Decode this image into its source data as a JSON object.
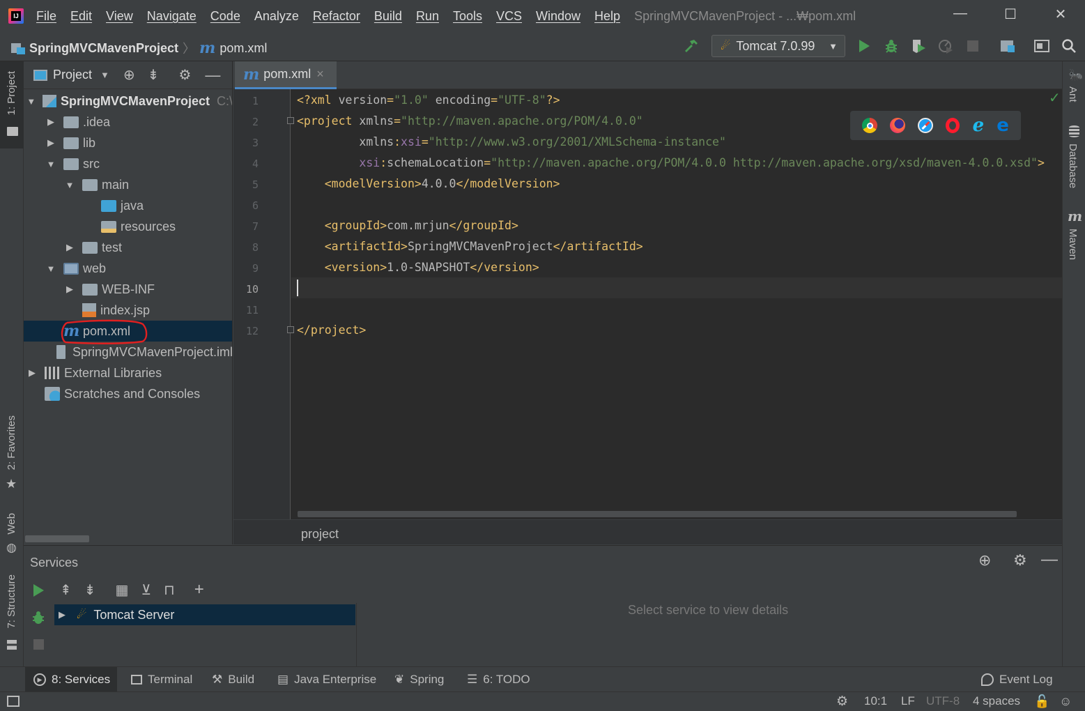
{
  "menu": {
    "items": [
      "File",
      "Edit",
      "View",
      "Navigate",
      "Code",
      "Analyze",
      "Refactor",
      "Build",
      "Run",
      "Tools",
      "VCS",
      "Window",
      "Help"
    ],
    "window_title": "SpringMVCMavenProject - ...₩pom.xml",
    "minimize": "—",
    "maximize": "☐",
    "close": "✕"
  },
  "navbar": {
    "breadcrumb_project": "SpringMVCMavenProject",
    "breadcrumb_file": "pom.xml",
    "run_config": "Tomcat 7.0.99"
  },
  "left_strip": {
    "project_label": "1: Project",
    "favorites_label": "2: Favorites",
    "web_label": "Web",
    "structure_label": "7: Structure"
  },
  "right_strip": {
    "ant_label": "Ant",
    "database_label": "Database",
    "maven_label": "Maven"
  },
  "project_panel": {
    "title": "Project",
    "tree": [
      {
        "label": "SpringMVCMavenProject",
        "suffix": "C:\\",
        "depth": 0,
        "arrow": "open",
        "icon": "module",
        "bold": true
      },
      {
        "label": ".idea",
        "depth": 1,
        "arrow": "closed",
        "icon": "folder"
      },
      {
        "label": "lib",
        "depth": 1,
        "arrow": "closed",
        "icon": "folder"
      },
      {
        "label": "src",
        "depth": 1,
        "arrow": "open",
        "icon": "folder"
      },
      {
        "label": "main",
        "depth": 2,
        "arrow": "open",
        "icon": "folder"
      },
      {
        "label": "java",
        "depth": 3,
        "arrow": "none",
        "icon": "folder-blue"
      },
      {
        "label": "resources",
        "depth": 3,
        "arrow": "none",
        "icon": "folder-res"
      },
      {
        "label": "test",
        "depth": 2,
        "arrow": "closed",
        "icon": "folder"
      },
      {
        "label": "web",
        "depth": 1,
        "arrow": "open",
        "icon": "folder-web"
      },
      {
        "label": "WEB-INF",
        "depth": 2,
        "arrow": "closed",
        "icon": "folder"
      },
      {
        "label": "index.jsp",
        "depth": 2,
        "arrow": "none",
        "icon": "jsp"
      },
      {
        "label": "pom.xml",
        "depth": 1,
        "arrow": "none",
        "icon": "maven",
        "selected": true
      },
      {
        "label": "SpringMVCMavenProject.iml",
        "depth": 1,
        "arrow": "none",
        "icon": "file"
      },
      {
        "label": "External Libraries",
        "depth": 0,
        "arrow": "closed",
        "icon": "libs"
      },
      {
        "label": "Scratches and Consoles",
        "depth": 0,
        "arrow": "none",
        "icon": "scratch"
      }
    ]
  },
  "editor": {
    "tab_label": "pom.xml",
    "tab_close": "×",
    "line_numbers": [
      "1",
      "2",
      "3",
      "4",
      "5",
      "6",
      "7",
      "8",
      "9",
      "10",
      "11",
      "12"
    ],
    "current_line": "10",
    "lines": [
      [
        {
          "c": "tg",
          "t": "<?xml "
        },
        {
          "c": "at",
          "t": "version"
        },
        {
          "c": "tg",
          "t": "="
        },
        {
          "c": "sv",
          "t": "\"1.0\""
        },
        {
          "c": "at",
          "t": " encoding"
        },
        {
          "c": "tg",
          "t": "="
        },
        {
          "c": "sv",
          "t": "\"UTF-8\""
        },
        {
          "c": "tg",
          "t": "?>"
        }
      ],
      [
        {
          "c": "tg",
          "t": "<project "
        },
        {
          "c": "at",
          "t": "xmlns"
        },
        {
          "c": "tg",
          "t": "="
        },
        {
          "c": "sv",
          "t": "\"http://maven.apache.org/POM/4.0.0\""
        }
      ],
      [
        {
          "c": "at",
          "t": "         xmlns"
        },
        {
          "c": "tg",
          "t": ":"
        },
        {
          "c": "ns",
          "t": "xsi"
        },
        {
          "c": "tg",
          "t": "="
        },
        {
          "c": "sv",
          "t": "\"http://www.w3.org/2001/XMLSchema-instance\""
        }
      ],
      [
        {
          "c": "ns",
          "t": "         xsi"
        },
        {
          "c": "tg",
          "t": ":"
        },
        {
          "c": "at",
          "t": "schemaLocation"
        },
        {
          "c": "tg",
          "t": "="
        },
        {
          "c": "sv",
          "t": "\"http://maven.apache.org/POM/4.0.0 http://maven.apache.org/xsd/maven-4.0.0.xsd\""
        },
        {
          "c": "tg",
          "t": ">"
        }
      ],
      [
        {
          "c": "tg",
          "t": "    <modelVersion>"
        },
        {
          "c": "at",
          "t": "4.0.0"
        },
        {
          "c": "tg",
          "t": "</modelVersion>"
        }
      ],
      [],
      [
        {
          "c": "tg",
          "t": "    <groupId>"
        },
        {
          "c": "at",
          "t": "com.mrjun"
        },
        {
          "c": "tg",
          "t": "</groupId>"
        }
      ],
      [
        {
          "c": "tg",
          "t": "    <artifactId>"
        },
        {
          "c": "at",
          "t": "SpringMVCMavenProject"
        },
        {
          "c": "tg",
          "t": "</artifactId>"
        }
      ],
      [
        {
          "c": "tg",
          "t": "    <version>"
        },
        {
          "c": "at",
          "t": "1.0-SNAPSHOT"
        },
        {
          "c": "tg",
          "t": "</version>"
        }
      ],
      [],
      [],
      [
        {
          "c": "tg",
          "t": "</project>"
        }
      ]
    ],
    "breadcrumb": "project"
  },
  "services": {
    "title": "Services",
    "tree_item": "Tomcat Server",
    "empty_message": "Select service to view details"
  },
  "bottom_tabs": {
    "services": "8: Services",
    "terminal": "Terminal",
    "build": "Build",
    "java_enterprise": "Java Enterprise",
    "spring": "Spring",
    "todo": "6: TODO",
    "event_log": "Event Log"
  },
  "status": {
    "position": "10:1",
    "line_sep": "LF",
    "encoding": "UTF-8",
    "indent": "4 spaces"
  },
  "colors": {
    "accent": "#4a88c7",
    "run_green": "#499c54",
    "selection": "#0d293e",
    "annotation_red": "#e02020"
  }
}
